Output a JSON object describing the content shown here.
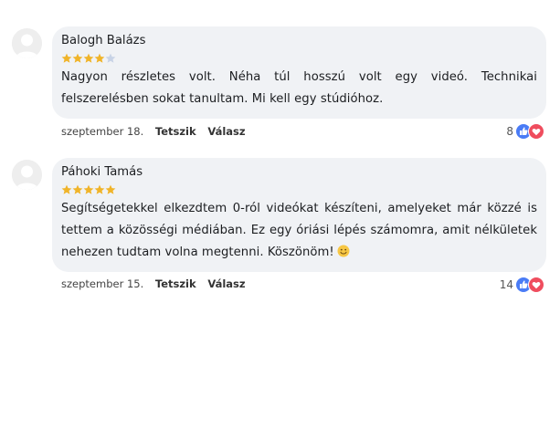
{
  "comments": [
    {
      "author": "Balogh Balázs",
      "rating": 4,
      "max_rating": 5,
      "text": "Nagyon részletes volt. Néha túl hosszú volt egy videó. Technikai felszerelésben sokat tanultam. Mi kell egy stúdióhoz.",
      "date": "szeptember 18.",
      "like_label": "Tetszik",
      "reply_label": "Válasz",
      "reaction_count": "8",
      "has_emoji": false
    },
    {
      "author": "Páhoki Tamás",
      "rating": 5,
      "max_rating": 5,
      "text": "Segítségetekkel elkezdtem 0-ról videókat készíteni, amelyeket már közzé is tettem a közösségi médiában. Ez egy óriási lépés számomra, amit nélkületek nehezen tudtam volna megtenni. Köszönöm!",
      "date": "szeptember 15.",
      "like_label": "Tetszik",
      "reply_label": "Válasz",
      "reaction_count": "14",
      "has_emoji": true
    }
  ],
  "colors": {
    "star_filled": "#f0b429",
    "star_empty": "#c8d3e6",
    "bubble": "#f0f2f5",
    "like": "#4a7cf6",
    "love": "#ef4d5e"
  },
  "icons": {
    "avatar": "default-user-avatar-icon",
    "star": "star-icon",
    "like": "thumbs-up-icon",
    "love": "heart-icon",
    "emoji": "smiling-face-icon"
  }
}
